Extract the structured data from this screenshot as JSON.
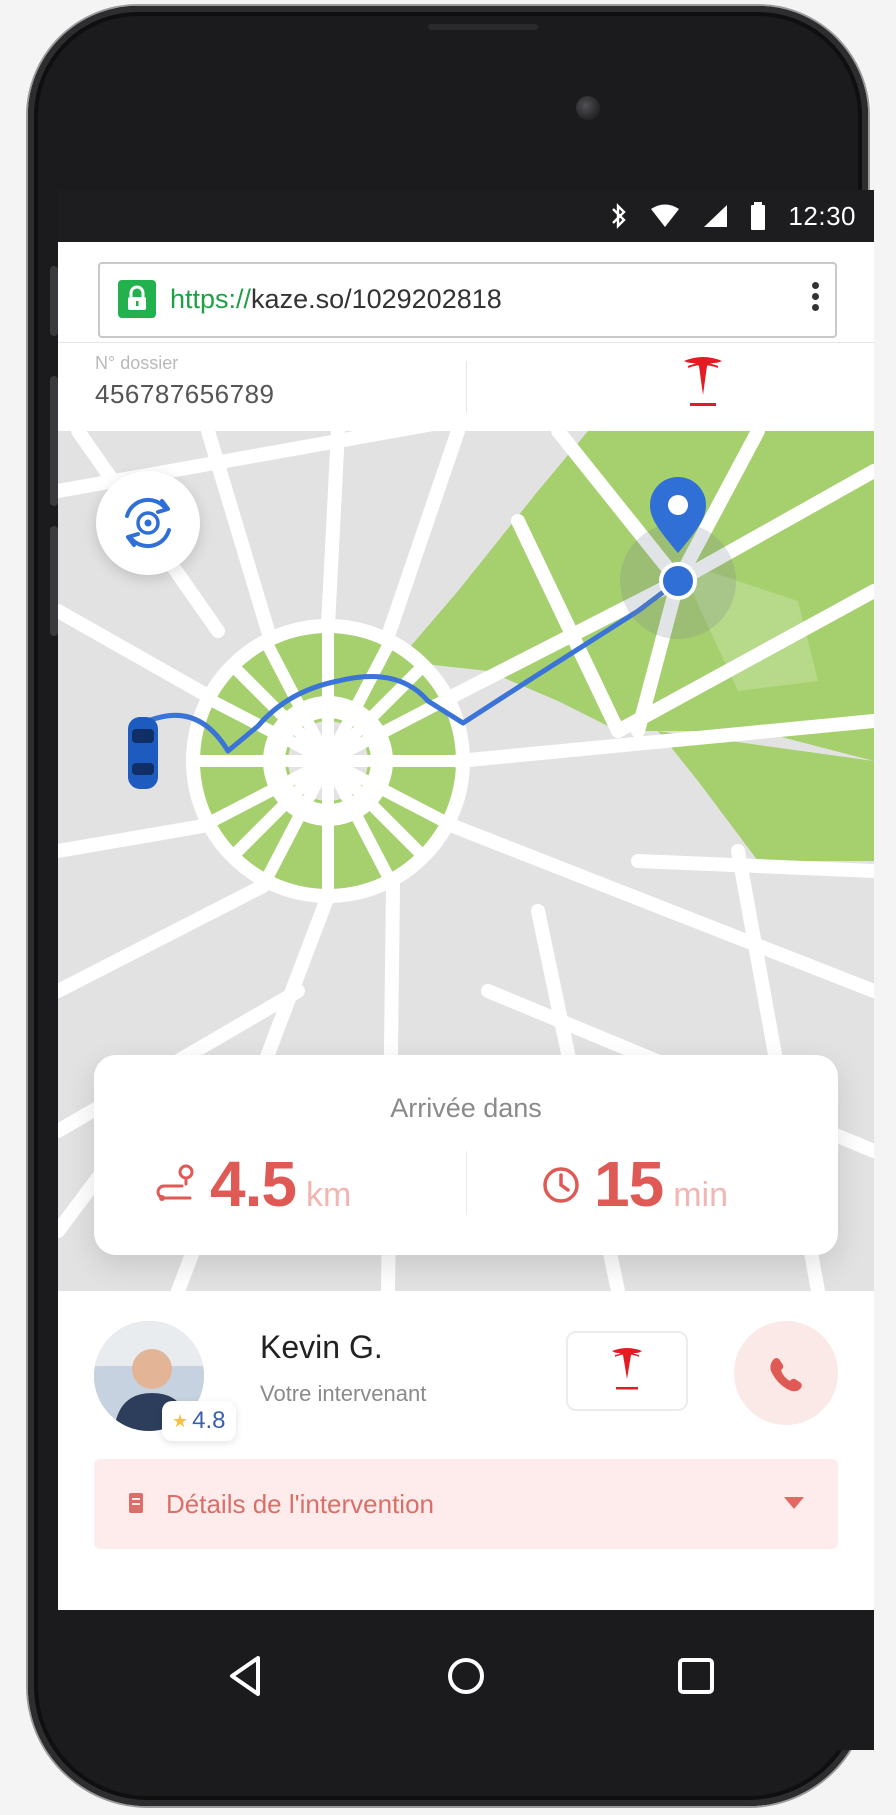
{
  "status_bar": {
    "time": "12:30",
    "icons": [
      "bluetooth-icon",
      "wifi-icon",
      "signal-icon",
      "battery-icon"
    ]
  },
  "browser": {
    "url_scheme": "https://",
    "url_rest": "kaze.so/1029202818",
    "lock_color": "#22b14c"
  },
  "dossier": {
    "label": "N° dossier",
    "number": "456787656789",
    "brand_logo": "tesla-logo"
  },
  "eta": {
    "title": "Arrivée dans",
    "distance_value": "4.5",
    "distance_unit": "km",
    "time_value": "15",
    "time_unit": "min",
    "accent_color": "#e05a55"
  },
  "technician": {
    "name": "Kevin G.",
    "role": "Votre intervenant",
    "rating": "4.8"
  },
  "details": {
    "label": "Détails de l'intervention"
  },
  "navigation": {
    "buttons": [
      "back-icon",
      "home-icon",
      "recents-icon"
    ]
  }
}
